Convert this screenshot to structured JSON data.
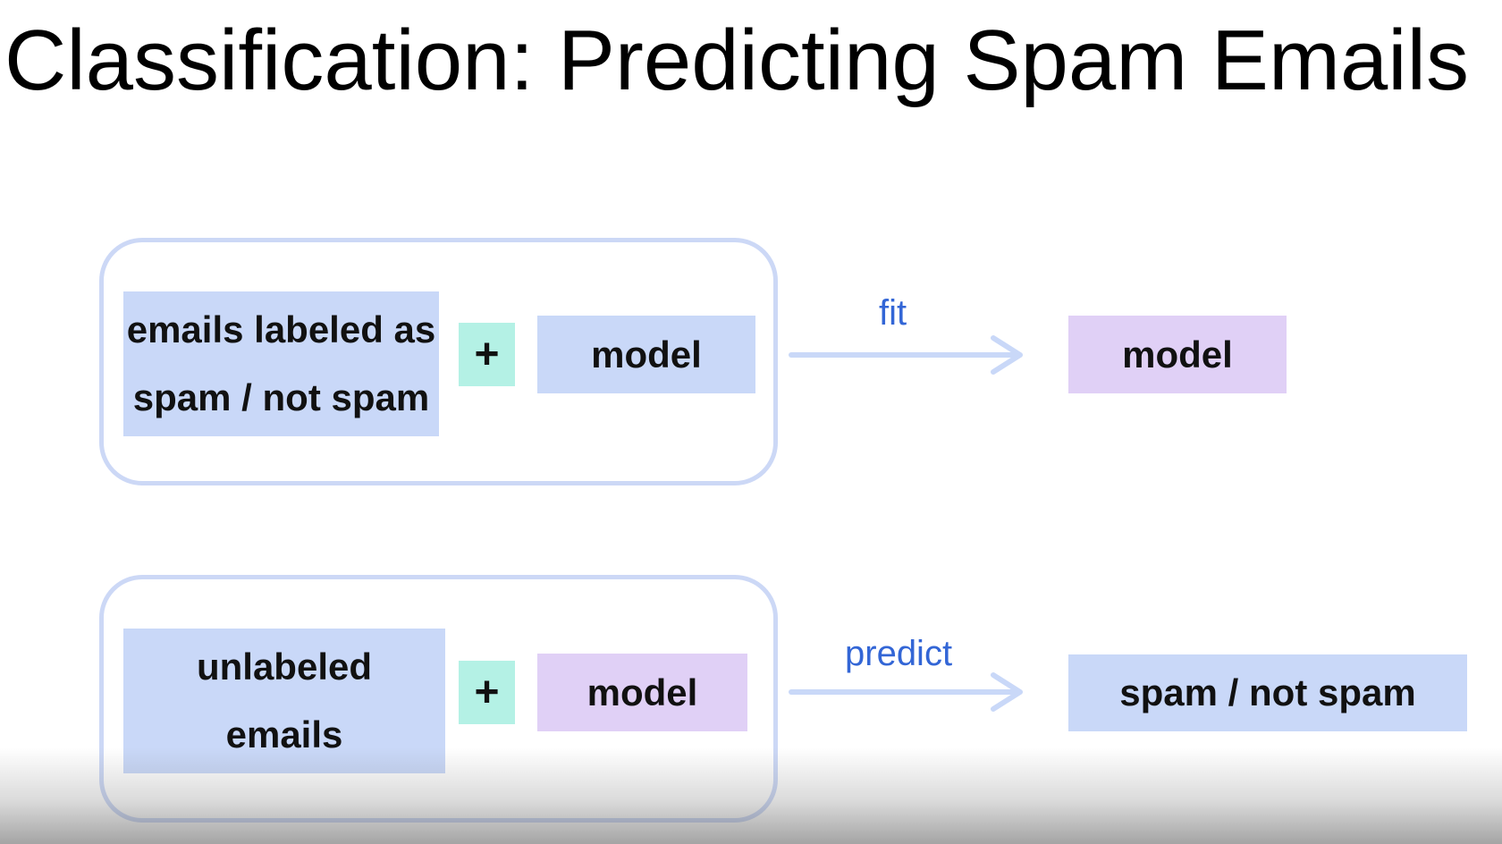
{
  "title": "Classification: Predicting Spam Emails",
  "rows": [
    {
      "input_line1": "emails labeled as",
      "input_line2": "spam / not spam",
      "plus": "+",
      "model": "model",
      "operation": "fit",
      "output": "model"
    },
    {
      "input_line1": "unlabeled",
      "input_line2": "emails",
      "plus": "+",
      "model": "model",
      "operation": "predict",
      "output": "spam / not spam"
    }
  ],
  "colors": {
    "group_border": "#ccd8f6",
    "data_box": "#c9d8f8",
    "model_box": "#e0d0f6",
    "plus_box": "#b4f1e5",
    "operation_text": "#3366d6",
    "arrow": "#c9d8f8"
  }
}
